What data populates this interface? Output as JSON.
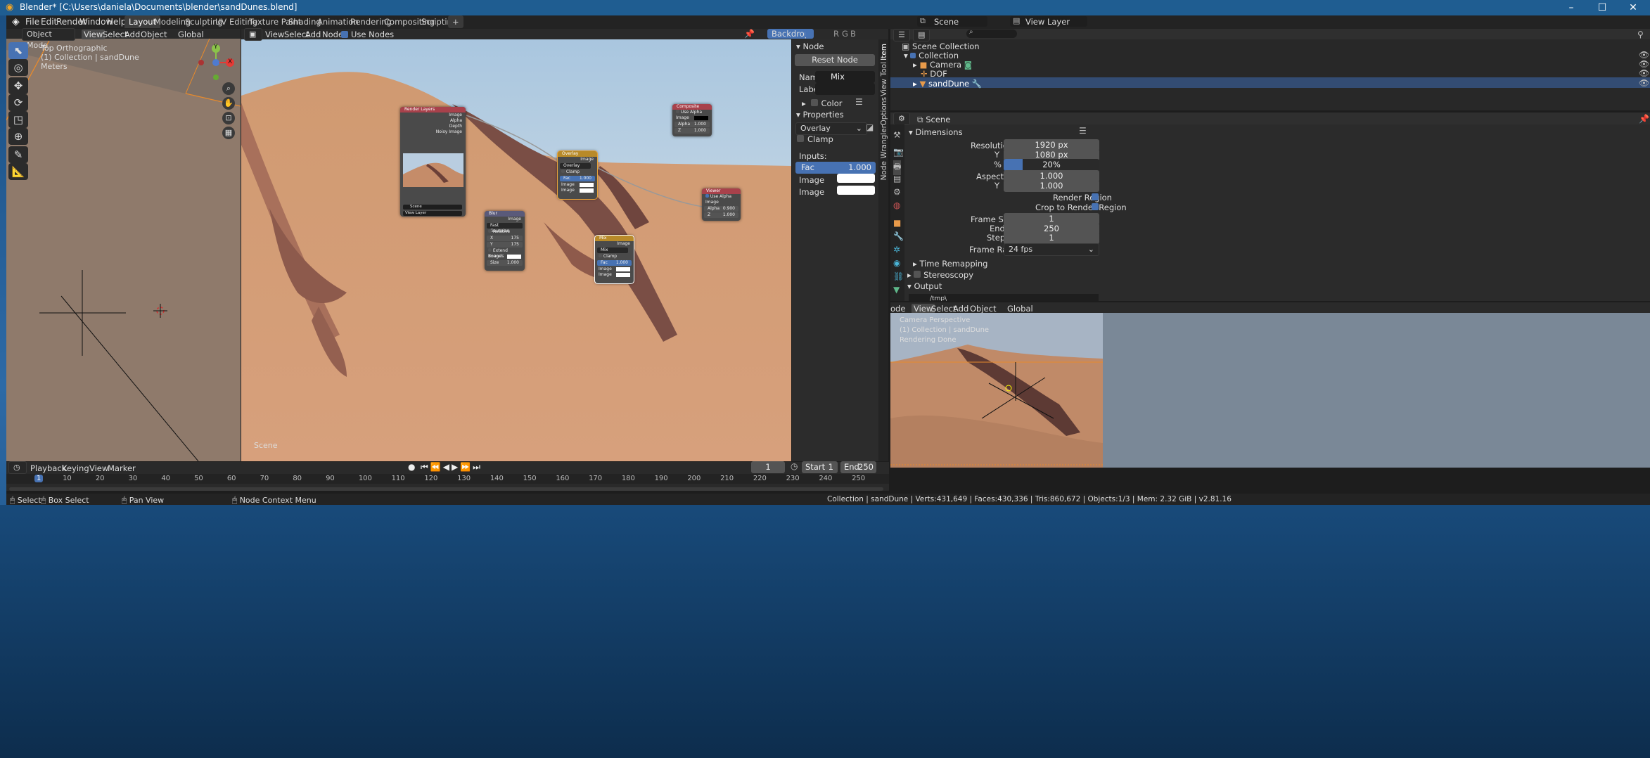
{
  "window": {
    "title": "Blender* [C:\\Users\\daniela\\Documents\\blender\\sandDunes.blend]"
  },
  "menu": [
    "File",
    "Edit",
    "Render",
    "Window",
    "Help"
  ],
  "workspaces": [
    "Layout",
    "Modeling",
    "Sculpting",
    "UV Editing",
    "Texture Paint",
    "Shading",
    "Animation",
    "Rendering",
    "Compositing",
    "Scripting",
    "+"
  ],
  "topright": {
    "scene": "Scene",
    "view_layer": "View Layer"
  },
  "viewport3d": {
    "mode": "Object Mode",
    "menus": [
      "View",
      "Select",
      "Add",
      "Object"
    ],
    "orientation": "Global",
    "overlay_lines": [
      "Top Orthographic",
      "(1) Collection | sandDune",
      "Meters"
    ],
    "axis_labels": {
      "x": "X",
      "y": "Y"
    }
  },
  "node_editor": {
    "menus": [
      "View",
      "Select",
      "Add",
      "Node"
    ],
    "use_nodes_label": "Use Nodes",
    "backdrop_label": "Backdrop",
    "scene_label": "Scene",
    "channel_letters": [
      "R",
      "G",
      "B"
    ],
    "nodes": {
      "render_layers": {
        "title": "Render Layers",
        "outputs": [
          "Image",
          "Alpha",
          "Depth",
          "Noisy Image"
        ],
        "scene": "Scene",
        "layer": "View Layer"
      },
      "composite": {
        "title": "Composite",
        "use_alpha": "Use Alpha",
        "image": "Image",
        "alpha": "Alpha",
        "alpha_val": "1.000",
        "z": "Z",
        "z_val": "1.000"
      },
      "overlay": {
        "title": "Overlay",
        "out": "Image",
        "blend": "Overlay",
        "clamp": "Clamp",
        "fac": "Fac",
        "fac_val": "1.000",
        "in1": "Image",
        "in2": "Image"
      },
      "viewer": {
        "title": "Viewer",
        "use_alpha": "Use Alpha",
        "image": "Image",
        "alpha": "Alpha",
        "alpha_val": "0.900",
        "z": "Z",
        "z_val": "1.000"
      },
      "blur": {
        "title": "Blur",
        "out": "Image",
        "type": "Fast Gaussian",
        "relative": "Relative",
        "x": "X",
        "x_val": "175",
        "y": "Y",
        "y_val": "175",
        "extend": "Extend Bounds",
        "in": "Image",
        "size": "Size",
        "size_val": "1.000"
      },
      "mix": {
        "title": "Mix",
        "out": "Image",
        "blend": "Mix",
        "clamp": "Clamp",
        "fac": "Fac",
        "fac_val": "1.000",
        "in1": "Image",
        "in2": "Image"
      }
    }
  },
  "sidebar": {
    "section": "Node",
    "reset": "Reset Node",
    "name_label": "Name:",
    "name_val": "Mix",
    "label_label": "Label:",
    "color": "Color",
    "properties": "Properties",
    "blend": "Overlay",
    "clamp": "Clamp",
    "inputs": "Inputs:",
    "fac": "Fac",
    "fac_val": "1.000",
    "image1": "Image",
    "image2": "Image",
    "tabs": [
      "Item",
      "Tool",
      "View",
      "Options",
      "Node Wrangler"
    ]
  },
  "outliner": {
    "root": "Scene Collection",
    "items": [
      "Collection",
      "Camera",
      "DOF",
      "sandDune"
    ]
  },
  "properties": {
    "context": "Scene",
    "dimensions": "Dimensions",
    "res_x_label": "Resolution X",
    "res_x": "1920 px",
    "res_y_label": "Y",
    "res_y": "1080 px",
    "pct_label": "%",
    "pct": "20%",
    "pct_fill": 0.2,
    "aspect_x_label": "Aspect X",
    "aspect_x": "1.000",
    "aspect_y_label": "Y",
    "aspect_y": "1.000",
    "render_region": "Render Region",
    "crop": "Crop to Render Region",
    "frame_start_label": "Frame Start",
    "frame_start": "1",
    "end_label": "End",
    "end": "250",
    "step_label": "Step",
    "step": "1",
    "frame_rate_label": "Frame Rate",
    "frame_rate": "24 fps",
    "time_remap": "Time Remapping",
    "stereo": "Stereoscopy",
    "output": "Output",
    "path": "/tmp\\"
  },
  "camera_view": {
    "menus": [
      "View",
      "Select",
      "Add",
      "Object"
    ],
    "mode": "ode",
    "orientation": "Global",
    "overlay_lines": [
      "Camera Perspective",
      "(1) Collection | sandDune",
      "Rendering Done"
    ]
  },
  "timeline": {
    "menus": [
      "Playback",
      "Keying",
      "View",
      "Marker"
    ],
    "current": "1",
    "start_label": "Start",
    "start": "1",
    "end_label": "End",
    "end": "250",
    "ticks": [
      "1",
      "10",
      "20",
      "30",
      "40",
      "50",
      "60",
      "70",
      "80",
      "90",
      "100",
      "110",
      "120",
      "130",
      "140",
      "150",
      "160",
      "170",
      "180",
      "190",
      "200",
      "210",
      "220",
      "230",
      "240",
      "250"
    ]
  },
  "statusbar": {
    "select": "Select",
    "box_select": "Box Select",
    "pan": "Pan View",
    "context": "Node Context Menu",
    "stats": "Collection | sandDune | Verts:431,649 | Faces:430,336 | Tris:860,672 | Objects:1/3 | Mem: 2.32 GiB | v2.81.16"
  }
}
